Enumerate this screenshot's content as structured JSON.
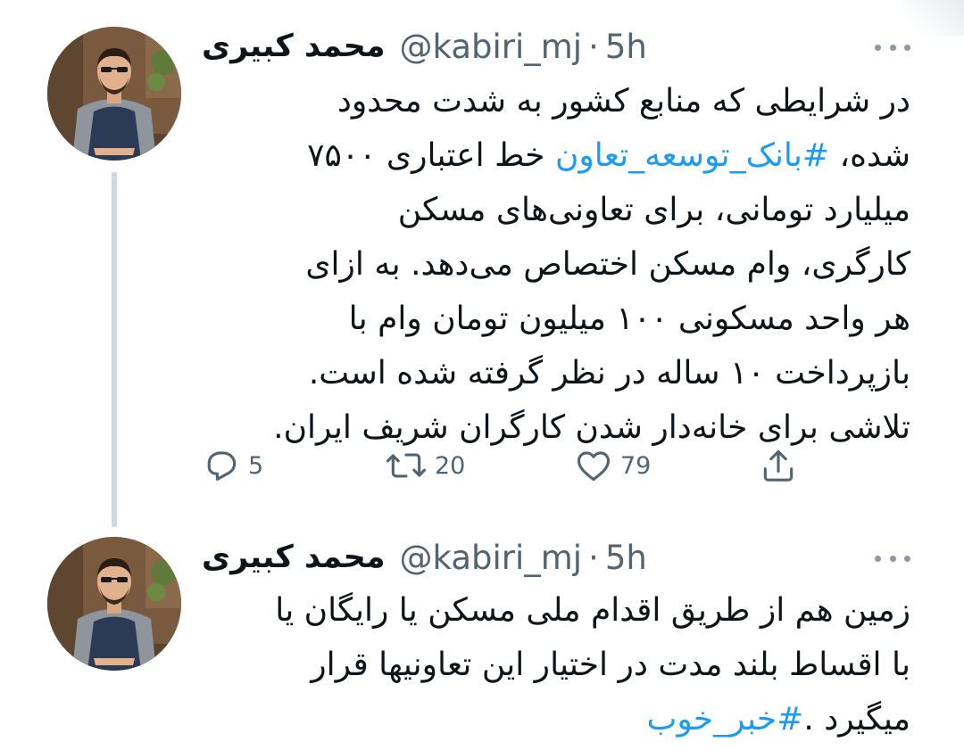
{
  "thread": [
    {
      "author_name": "محمد کبیری",
      "handle": "@kabiri_mj",
      "separator": "·",
      "time": "5h",
      "text_lines": [
        {
          "before": "در شرایطی که منابع کشور به شدت محدود",
          "hashtag": "",
          "after": ""
        },
        {
          "before": "شده، ",
          "hashtag": "#بانک_توسعه_تعاون",
          "after": " خط اعتباری ۷۵۰۰"
        },
        {
          "before": "میلیارد تومانی، برای تعاونی‌های مسکن",
          "hashtag": "",
          "after": ""
        },
        {
          "before": "کارگری، وام مسکن اختصاص می‌دهد. به ازای",
          "hashtag": "",
          "after": ""
        },
        {
          "before": "هر واحد مسکونی ۱۰۰ میلیون تومان وام با",
          "hashtag": "",
          "after": ""
        },
        {
          "before": "بازپرداخت ۱۰ ساله در نظر گرفته شده است.",
          "hashtag": "",
          "after": ""
        },
        {
          "before": "تلاشی برای خانه‌دار شدن کارگران شریف ایران.",
          "hashtag": "",
          "after": ""
        }
      ],
      "actions": {
        "reply_icon": "reply-icon",
        "reply_count": "5",
        "retweet_icon": "retweet-icon",
        "retweet_count": "20",
        "like_icon": "heart-icon",
        "like_count": "79",
        "share_icon": "share-icon"
      }
    },
    {
      "author_name": "محمد کبیری",
      "handle": "@kabiri_mj",
      "separator": "·",
      "time": "5h",
      "text_lines": [
        {
          "before": "زمین هم از طریق اقدام ملی مسکن یا رایگان یا",
          "hashtag": "",
          "after": ""
        },
        {
          "before": "با اقساط بلند مدت در اختیار این تعاونیها قرار",
          "hashtag": "",
          "after": ""
        },
        {
          "before": "میگیرد .",
          "hashtag": "#خبر_خوب",
          "after": ""
        }
      ]
    }
  ],
  "colors": {
    "text": "#0f1419",
    "secondary": "#536471",
    "hashtag": "#1d9bf0",
    "thread_line": "#cfd9de"
  }
}
